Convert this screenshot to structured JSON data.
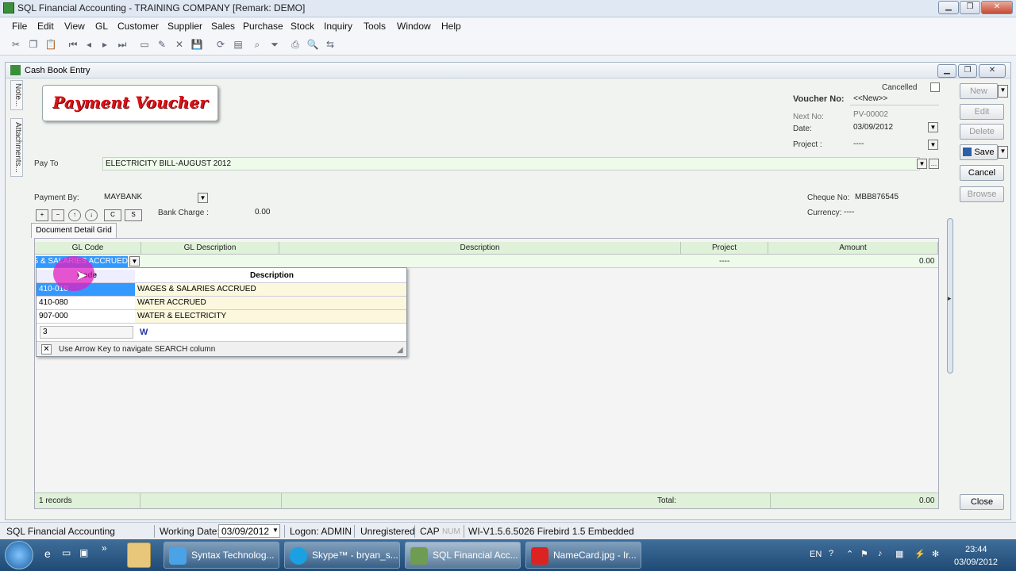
{
  "window": {
    "title": "SQL Financial Accounting - TRAINING COMPANY [Remark: DEMO]"
  },
  "menu": [
    "File",
    "Edit",
    "View",
    "GL",
    "Customer",
    "Supplier",
    "Sales",
    "Purchase",
    "Stock",
    "Inquiry",
    "Tools",
    "Window",
    "Help"
  ],
  "child": {
    "title": "Cash Book Entry",
    "side_tabs": [
      "Note...",
      "Attachments..."
    ]
  },
  "form": {
    "banner": "Payment Voucher",
    "cancelled_label": "Cancelled",
    "voucher_no_label": "Voucher No:",
    "voucher_no": "<<New>>",
    "next_no_label": "Next No:",
    "next_no": "PV-00002",
    "date_label": "Date:",
    "date": "03/09/2012",
    "project_label": "Project :",
    "project": "----",
    "pay_to_label": "Pay To",
    "pay_to": "ELECTRICITY BILL-AUGUST 2012",
    "payment_by_label": "Payment By:",
    "payment_by": "MAYBANK",
    "bank_charge_label": "Bank Charge :",
    "bank_charge": "0.00",
    "cheque_no_label": "Cheque No:",
    "cheque_no": "MBB876545",
    "currency_label": "Currency:",
    "currency": "----",
    "grid_buttons": [
      "+",
      "−",
      "↑",
      "↓",
      "C",
      "S"
    ]
  },
  "side_buttons": {
    "new": "New",
    "edit": "Edit",
    "delete": "Delete",
    "save": "Save",
    "cancel": "Cancel",
    "browse": "Browse",
    "close": "Close"
  },
  "grid": {
    "tab": "Document Detail Grid",
    "headers": [
      "GL Code",
      "GL Description",
      "Description",
      "Project",
      "Amount"
    ],
    "row": {
      "gl_code": "S & SALARIES ACCRUED",
      "project": "----",
      "amount": "0.00"
    },
    "footer": {
      "records": "1 records",
      "total_label": "Total:",
      "total": "0.00"
    }
  },
  "lookup": {
    "header_code": "Code",
    "header_desc": "Description",
    "rows": [
      {
        "code": "410-010",
        "desc": "WAGES & SALARIES ACCRUED"
      },
      {
        "code": "410-080",
        "desc": "WATER ACCRUED"
      },
      {
        "code": "907-000",
        "desc": "WATER & ELECTRICITY"
      }
    ],
    "search_value": "3",
    "search_text": "W",
    "hint": "Use Arrow Key to navigate SEARCH column"
  },
  "statusbar": {
    "app": "SQL Financial Accounting",
    "working_date_label": "Working Date:",
    "working_date": "03/09/2012",
    "logon": "Logon: ADMIN",
    "registered": "Unregistered",
    "cap": "CAP",
    "num": "NUM",
    "version": "WI-V1.5.6.5026 Firebird 1.5 Embedded"
  },
  "taskbar": {
    "tasks": [
      "Syntax Technolog...",
      "Skype™ - bryan_s...",
      "SQL Financial Acc...",
      "NameCard.jpg - Ir..."
    ],
    "lang": "EN",
    "time": "23:44",
    "date": "03/09/2012"
  },
  "colors": {
    "accent_green": "#eefaea",
    "selection": "#3399ff",
    "highlight_cursor": "#e020c0"
  }
}
